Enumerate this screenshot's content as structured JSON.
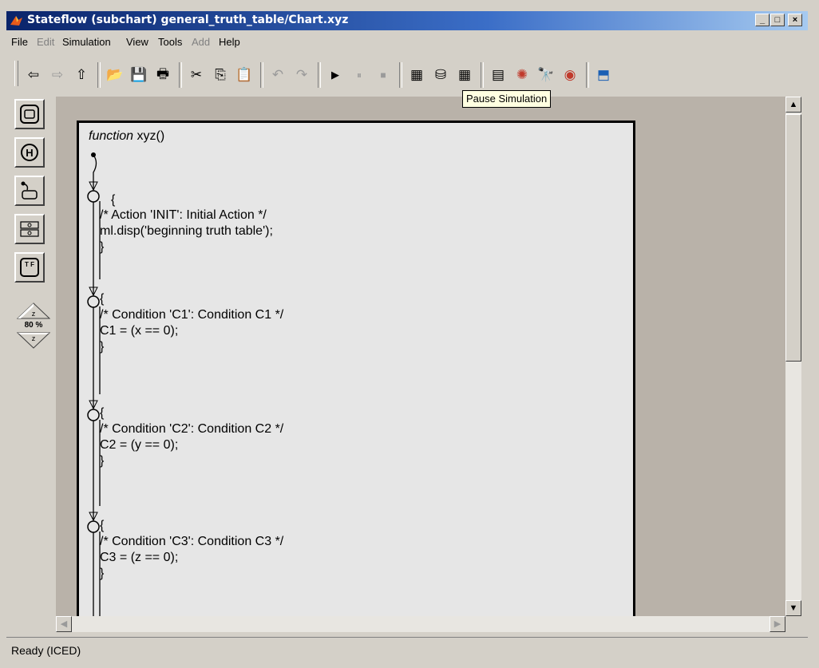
{
  "window": {
    "title": "Stateflow (subchart) general_truth_table/Chart.xyz",
    "min_glyph": "_",
    "max_glyph": "□",
    "close_glyph": "×"
  },
  "menu": {
    "items": [
      {
        "label": "File",
        "enabled": true
      },
      {
        "label": "Edit",
        "enabled": false
      },
      {
        "label": "Simulation",
        "enabled": true
      },
      {
        "label": "View",
        "enabled": true
      },
      {
        "label": "Tools",
        "enabled": true
      },
      {
        "label": "Add",
        "enabled": false
      },
      {
        "label": "Help",
        "enabled": true
      }
    ]
  },
  "toolbar": {
    "buttons": [
      {
        "name": "back-icon",
        "glyph": "⇦",
        "enabled": true
      },
      {
        "name": "forward-icon",
        "glyph": "⇨",
        "enabled": false
      },
      {
        "name": "up-icon",
        "glyph": "⇧",
        "enabled": true
      },
      {
        "name": "open-folder-icon",
        "glyph": "📂",
        "enabled": true
      },
      {
        "name": "save-icon",
        "glyph": "💾",
        "enabled": true
      },
      {
        "name": "print-icon",
        "glyph": "🖶",
        "enabled": true
      },
      {
        "name": "cut-icon",
        "glyph": "✂",
        "enabled": true
      },
      {
        "name": "copy-icon",
        "glyph": "⎘",
        "enabled": true
      },
      {
        "name": "paste-icon",
        "glyph": "📋",
        "enabled": true
      },
      {
        "name": "undo-icon",
        "glyph": "↶",
        "enabled": false
      },
      {
        "name": "redo-icon",
        "glyph": "↷",
        "enabled": false
      },
      {
        "name": "play-icon",
        "glyph": "▶",
        "enabled": true
      },
      {
        "name": "pause-icon",
        "glyph": "⏸",
        "enabled": false
      },
      {
        "name": "stop-icon",
        "glyph": "■",
        "enabled": false
      },
      {
        "name": "build-icon",
        "glyph": "▦",
        "enabled": true
      },
      {
        "name": "incremental-build-icon",
        "glyph": "⛁",
        "enabled": true
      },
      {
        "name": "rebuild-icon",
        "glyph": "▦",
        "enabled": true
      },
      {
        "name": "explorer-icon",
        "glyph": "▤",
        "enabled": true
      },
      {
        "name": "debugger-icon",
        "glyph": "✺",
        "enabled": true
      },
      {
        "name": "find-icon",
        "glyph": "🔭",
        "enabled": true
      },
      {
        "name": "target-icon",
        "glyph": "◉",
        "enabled": true
      },
      {
        "name": "parent-icon",
        "glyph": "⬒",
        "enabled": true
      }
    ],
    "tooltip": "Pause Simulation"
  },
  "palette": {
    "zoom_label": "80 %"
  },
  "chart": {
    "function_keyword": "function",
    "function_name": "xyz()",
    "blocks": [
      {
        "lines": [
          "{",
          "/* Action 'INIT': Initial Action */",
          "ml.disp('beginning truth table');",
          "}"
        ]
      },
      {
        "lines": [
          "{",
          "/* Condition 'C1': Condition C1 */",
          "C1 = (x == 0);",
          "}"
        ]
      },
      {
        "lines": [
          "{",
          "/* Condition 'C2': Condition C2 */",
          "C2 = (y == 0);",
          "}"
        ]
      },
      {
        "lines": [
          "{",
          "/* Condition 'C3': Condition C3 */",
          "C3 = (z == 0);",
          "}"
        ]
      }
    ]
  },
  "statusbar": {
    "text": "Ready (ICED)"
  },
  "colors": {
    "title_start": "#0a246a",
    "title_end": "#a6caf0",
    "canvas_bg": "#b9b2a9",
    "function_bg": "#e6e6e6",
    "tooltip_bg": "#ffffe1"
  }
}
